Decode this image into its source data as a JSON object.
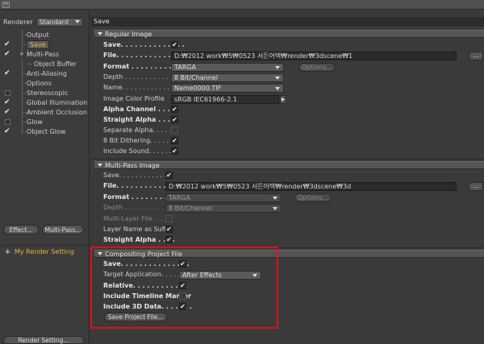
{
  "left_panel": {
    "renderer_label": "Renderer",
    "renderer_value": "Standard",
    "tree": [
      {
        "label": "Output",
        "checked": null
      },
      {
        "label": "Save",
        "checked": true
      },
      {
        "label": "Multi-Pass",
        "checked": true
      },
      {
        "label": "Object Buffer",
        "checked": null
      },
      {
        "label": "Anti-Aliasing",
        "checked": true
      },
      {
        "label": "Options",
        "checked": null
      },
      {
        "label": "Stereoscopic",
        "checked": false
      },
      {
        "label": "Global Illumination",
        "checked": true
      },
      {
        "label": "Ambient Occlusion",
        "checked": true
      },
      {
        "label": "Glow",
        "checked": false
      },
      {
        "label": "Object Glow",
        "checked": true
      }
    ],
    "effect_button": "Effect...",
    "multipass_button": "Multi-Pass...",
    "render_setting_item": "My Render Setting",
    "render_setting_button": "Render Setting..."
  },
  "tab_title": "Save",
  "regular_image": {
    "header": "Regular Image",
    "save_label": "Save. . . . . . . . . . . . . .",
    "file_label": "File. . . . . . . . . . . . . .",
    "file_value": "D:₩2012 work₩5₩0523 서든어택₩render₩3dscene₩1",
    "browse": "...",
    "format_label": "Format . . . . . . . . . .",
    "format_value": "TARGA",
    "options_button": "Options...",
    "depth_label": "Depth . . . . . . . . . . .",
    "depth_value": "8 Bit/Channel",
    "name_label": "Name. . . . . . . . . . . .",
    "name_value": "Name0000.TIF",
    "color_profile_label": "Image Color Profile",
    "color_profile_value": "sRGB IEC61966-2.1",
    "alpha_label": "Alpha Channel . . .",
    "straight_alpha_label": "Straight Alpha . . . .",
    "separate_alpha_label": "Separate Alpha. . . .",
    "dithering_label": "8 Bit Dithering. . . . .",
    "include_sound_label": "Include Sound. . . . . ."
  },
  "multipass_image": {
    "header": "Multi-Pass Image",
    "save_label": "Save. . . . . . . . . . . . .",
    "file_label": "File. . . . . . . . . . . . .",
    "file_value": "D:₩2012 work₩5₩0523 서든어택₩render₩3dscene₩3d",
    "browse": "...",
    "format_label": "Format . . . . . . . . .",
    "format_value": "TARGA",
    "options_button": "Options...",
    "depth_label": "Depth . . . . . . . . . .",
    "depth_value": "8 Bit/Channel",
    "multilayer_label": "Multi-Layer File. . . . .",
    "layer_name_label": "Layer Name as Suffix",
    "straight_alpha_label": "Straight Alpha . . . ."
  },
  "compositing": {
    "header": "Compositing Project File",
    "save_label": "Save. . . . . . . . . . . . . . .",
    "target_label": "Target Application. . . . .",
    "target_value": "After Effects",
    "relative_label": "Relative. . . . . . . . . . . .",
    "timeline_label": "Include Timeline Marker",
    "include3d_label": "Include 3D Data. . . . . . .",
    "save_project_button": "Save Project File..."
  },
  "colors": {
    "accent_selected": "#f0b040",
    "highlight_box": "#e01010"
  }
}
